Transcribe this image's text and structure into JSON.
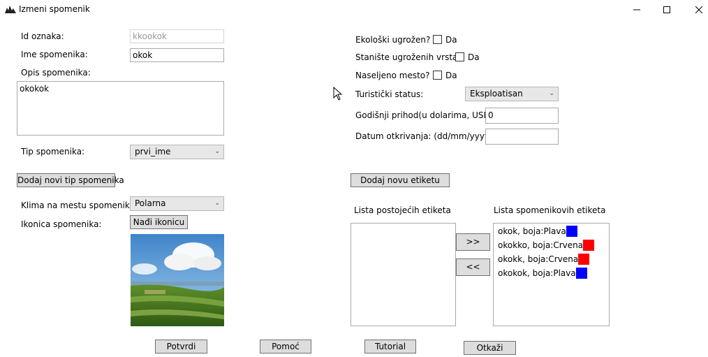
{
  "window": {
    "title": "Izmeni spomenik",
    "minimize": "—",
    "maximize": "☐",
    "close": "✕"
  },
  "left": {
    "id_label": "Id oznaka:",
    "id_value": "kkookok",
    "name_label": "Ime spomenika:",
    "name_value": "okok",
    "desc_label": "Opis spomenika:",
    "desc_value": "okokok",
    "type_label": "Tip spomenika:",
    "type_value": "prvi_ime",
    "add_type_button": "Dodaj novi tip spomenika",
    "climate_label": "Klima na mestu spomenika:",
    "climate_value": "Polarna",
    "icon_label": "Ikonica spomenika:",
    "find_icon_button": "Nađi ikonicu"
  },
  "right": {
    "eco_label": "Ekološki ugrožen?",
    "eco_da": "Da",
    "habitat_label": "Stanište ugroženih vrsta?",
    "habitat_da": "Da",
    "settlement_label": "Naseljeno mesto?",
    "settlement_da": "Da",
    "tourist_label": "Turistički status:",
    "tourist_value": "Eksploatisan",
    "income_label": "Godišnji prihod(u dolarima, USD):",
    "income_value": "0",
    "date_label": "Datum otkrivanja: (dd/mm/yyyy)",
    "date_value": "",
    "add_tag_button": "Dodaj novu etiketu",
    "existing_tags_label": "Lista postojećih etiketa",
    "monument_tags_label": "Lista spomenikovih etiketa",
    "move_right": ">>",
    "move_left": "<<",
    "tags": [
      {
        "text": "okok, boja:Plava",
        "color": "#0000ff"
      },
      {
        "text": "okokko, boja:Crvena",
        "color": "#ff0000"
      },
      {
        "text": "okokk, boja:Crvena",
        "color": "#ff0000"
      },
      {
        "text": "okokok, boja:Plava",
        "color": "#0000ff"
      }
    ]
  },
  "footer": {
    "confirm": "Potvrdi",
    "help": "Pomoć",
    "tutorial": "Tutorial",
    "cancel": "Otkaži"
  }
}
